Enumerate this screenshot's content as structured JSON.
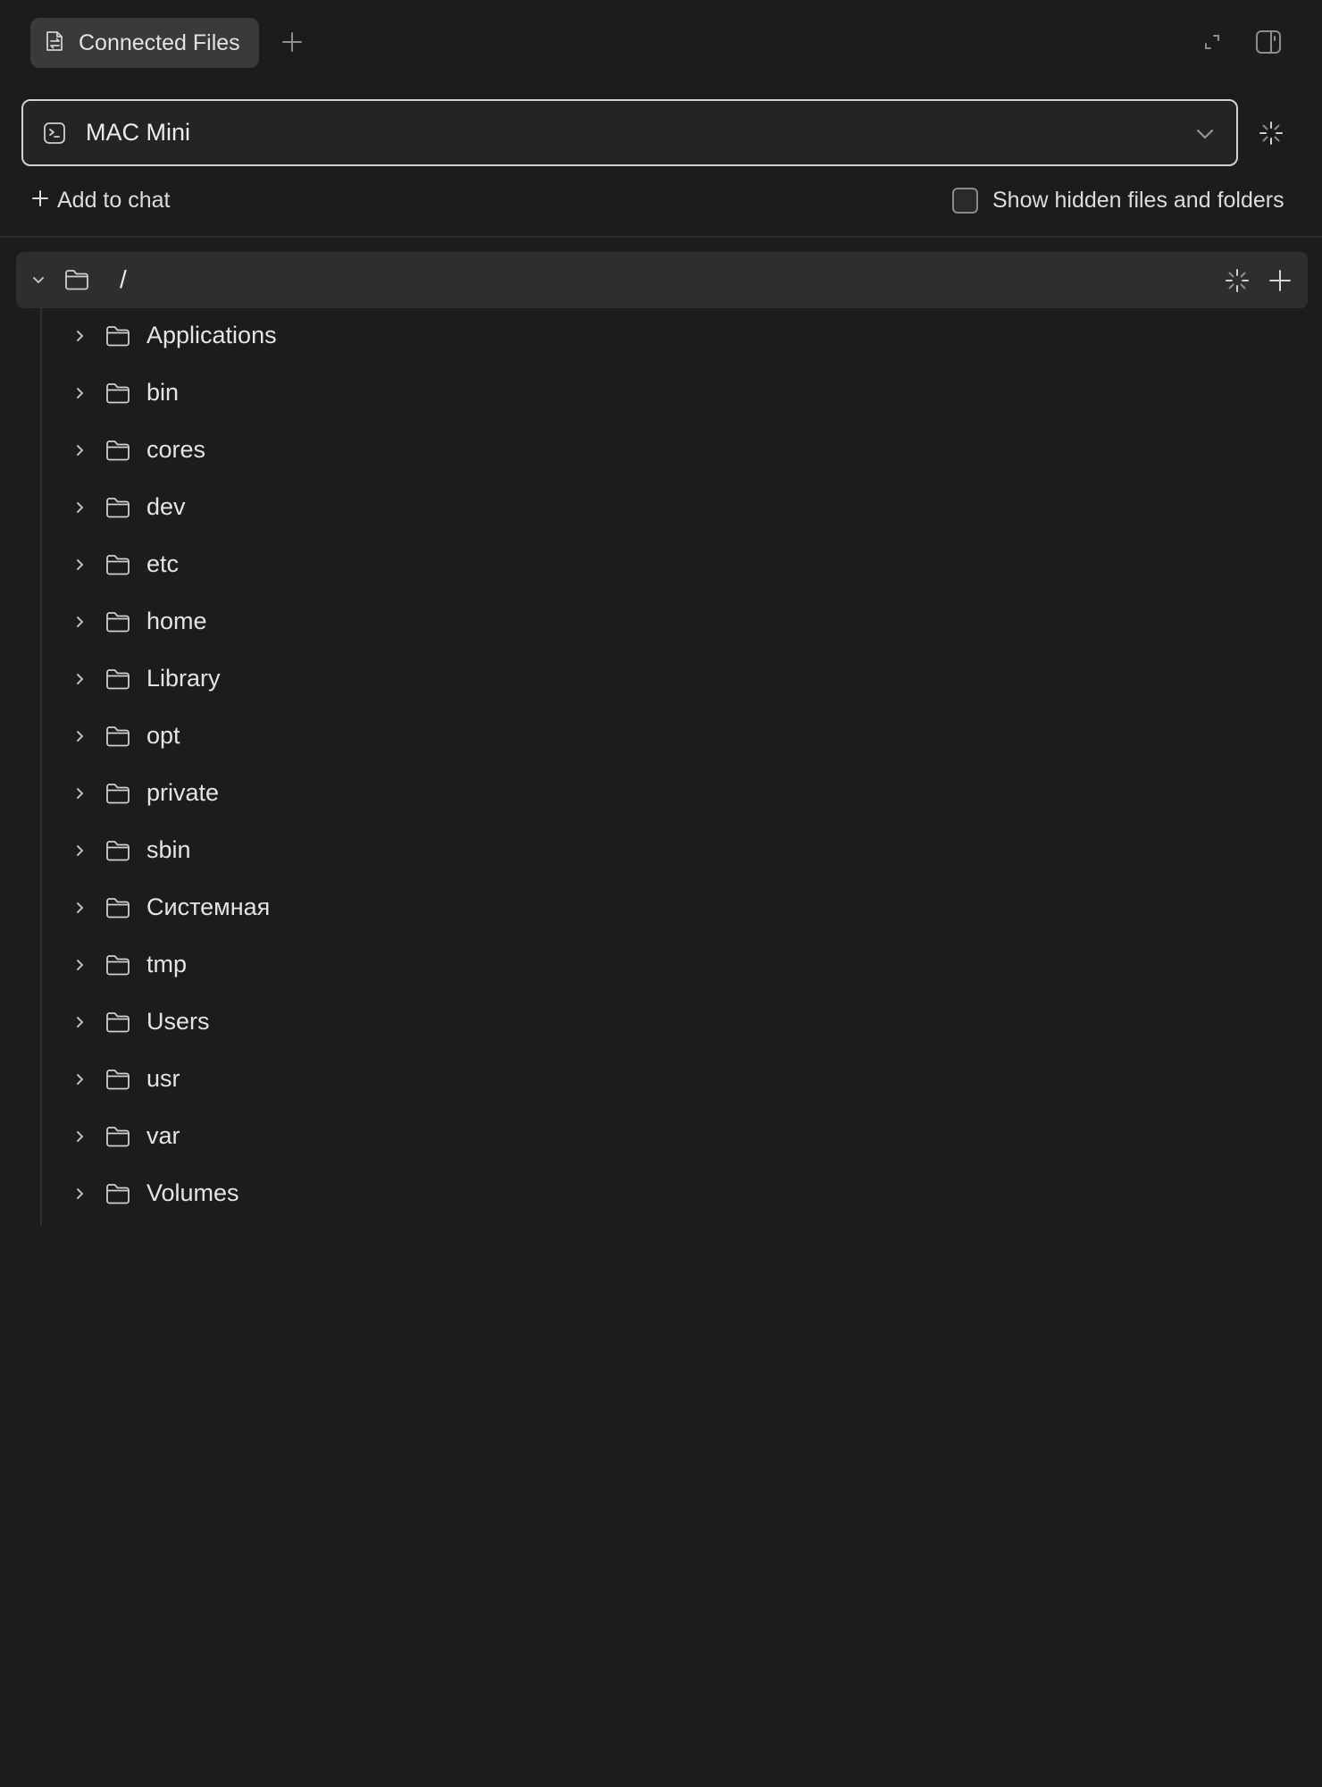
{
  "tabs": [
    {
      "label": "Connected Files",
      "icon": "connected-files-icon"
    }
  ],
  "device_selector": {
    "value": "MAC Mini",
    "icon": "terminal-icon"
  },
  "actions": {
    "add_to_chat": "Add to chat",
    "show_hidden_label": "Show hidden files and folders",
    "show_hidden_checked": false
  },
  "tree": {
    "root": {
      "name": "/",
      "expanded": true
    },
    "items": [
      {
        "name": "Applications"
      },
      {
        "name": "bin"
      },
      {
        "name": "cores"
      },
      {
        "name": "dev"
      },
      {
        "name": "etc"
      },
      {
        "name": "home"
      },
      {
        "name": "Library"
      },
      {
        "name": "opt"
      },
      {
        "name": "private"
      },
      {
        "name": "sbin"
      },
      {
        "name": "Системная"
      },
      {
        "name": "tmp"
      },
      {
        "name": "Users"
      },
      {
        "name": "usr"
      },
      {
        "name": "var"
      },
      {
        "name": "Volumes"
      }
    ]
  },
  "colors": {
    "background": "#1c1c1c",
    "tab_active": "#3a3a3a",
    "root_row": "#2e2e2e",
    "text": "#e4e4e4"
  }
}
